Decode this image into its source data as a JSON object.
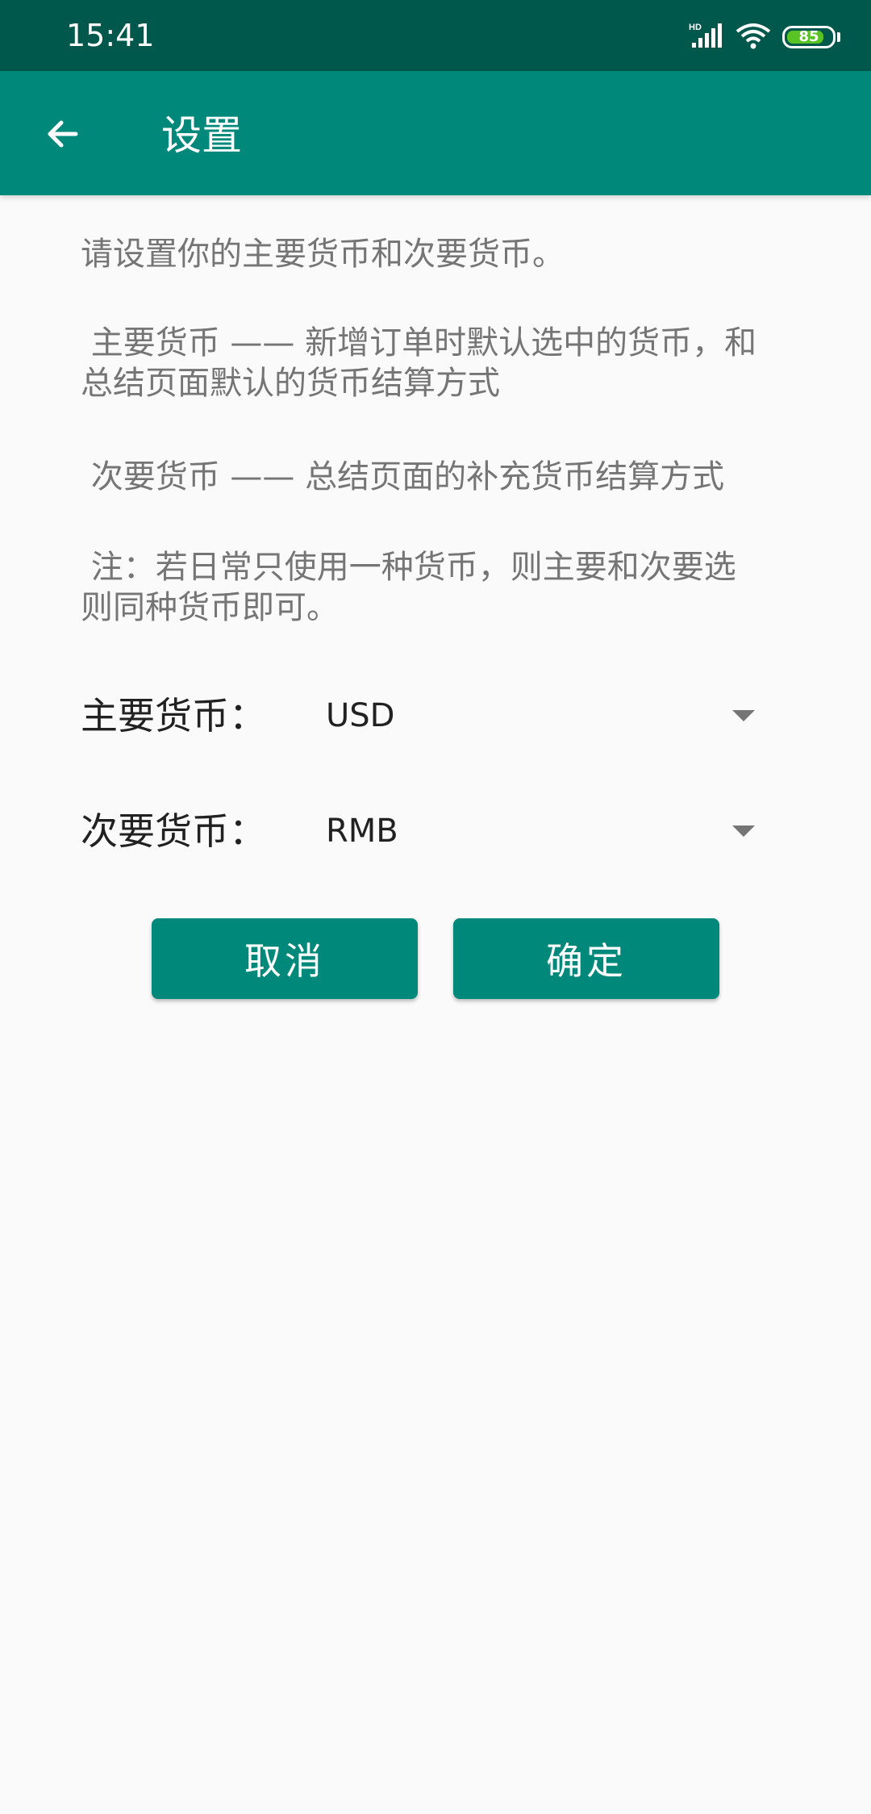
{
  "status_bar": {
    "time": "15:41",
    "network_label": "HD",
    "battery_level": 85,
    "battery_text": "85",
    "battery_color": "#58c322"
  },
  "app_bar": {
    "title": "设置",
    "back_icon": "arrow-left-icon",
    "color": "#00897b"
  },
  "description": {
    "line1": "请设置你的主要货币和次要货币。",
    "line2": " 主要货币 —— 新增订单时默认选中的货币，和\n总结页面默认的货币结算方式",
    "line3": " 次要货币 —— 总结页面的补充货币结算方式",
    "line4": " 注：若日常只使用一种货币，则主要和次要选\n则同种货币即可。"
  },
  "form": {
    "primary_label": "主要货币：",
    "primary_value": "USD",
    "secondary_label": "次要货币：",
    "secondary_value": "RMB"
  },
  "buttons": {
    "cancel": "取消",
    "confirm": "确定"
  }
}
